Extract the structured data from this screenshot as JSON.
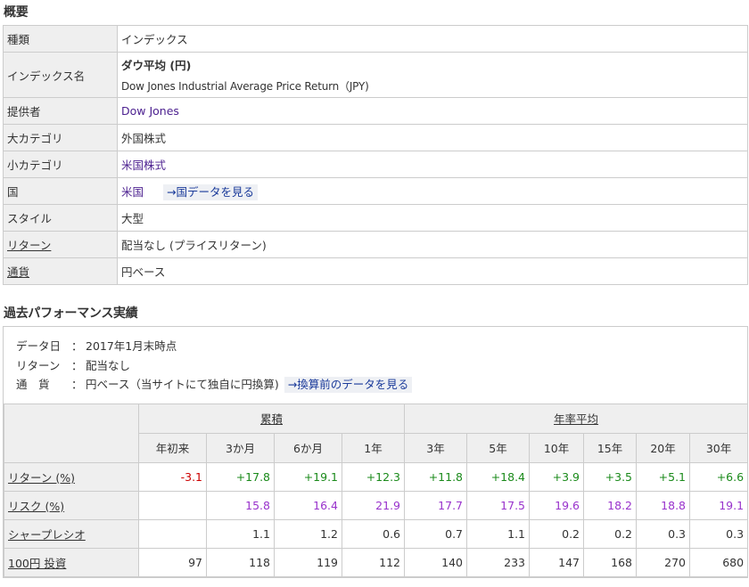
{
  "overview": {
    "title": "概要",
    "rows": {
      "type": {
        "label": "種類",
        "value": "インデックス"
      },
      "index_name": {
        "label": "インデックス名",
        "name_jp": "ダウ平均 (円)",
        "name_en": "Dow Jones Industrial Average Price Return（JPY)"
      },
      "provider": {
        "label": "提供者",
        "value": "Dow Jones"
      },
      "major_category": {
        "label": "大カテゴリ",
        "value": "外国株式"
      },
      "minor_category": {
        "label": "小カテゴリ",
        "value": "米国株式"
      },
      "country": {
        "label": "国",
        "value": "米国",
        "link": "→国データを見る"
      },
      "style": {
        "label": "スタイル",
        "value": "大型"
      },
      "return": {
        "label": "リターン",
        "value": "配当なし (プライスリターン)"
      },
      "currency": {
        "label": "通貨",
        "value": "円ベース"
      }
    }
  },
  "performance": {
    "title": "過去パフォーマンス実績",
    "meta": {
      "date_label": "データ日",
      "date_value": "2017年1月末時点",
      "return_label": "リターン",
      "return_value": "配当なし",
      "currency_label": "通　貨",
      "currency_value": "円ベース（当サイトにて独自に円換算)",
      "currency_link": "→換算前のデータを見る"
    },
    "groups": {
      "cumulative": "累積",
      "annualized": "年率平均"
    },
    "periods": [
      "年初来",
      "3か月",
      "6か月",
      "1年",
      "3年",
      "5年",
      "10年",
      "15年",
      "20年",
      "30年"
    ],
    "rows": [
      {
        "label": "リターン (%)",
        "cls": "ret",
        "values": [
          "-3.1",
          "+17.8",
          "+19.1",
          "+12.3",
          "+11.8",
          "+18.4",
          "+3.9",
          "+3.5",
          "+5.1",
          "+6.6"
        ]
      },
      {
        "label": "リスク (%)",
        "cls": "risk",
        "values": [
          "",
          "15.8",
          "16.4",
          "21.9",
          "17.7",
          "17.5",
          "19.6",
          "18.2",
          "18.8",
          "19.1"
        ]
      },
      {
        "label": "シャープレシオ",
        "cls": "plain",
        "values": [
          "",
          "1.1",
          "1.2",
          "0.6",
          "0.7",
          "1.1",
          "0.2",
          "0.2",
          "0.3",
          "0.3"
        ]
      },
      {
        "label": "100円 投資",
        "cls": "plain",
        "values": [
          "97",
          "118",
          "119",
          "112",
          "140",
          "233",
          "147",
          "168",
          "270",
          "680"
        ]
      }
    ]
  }
}
